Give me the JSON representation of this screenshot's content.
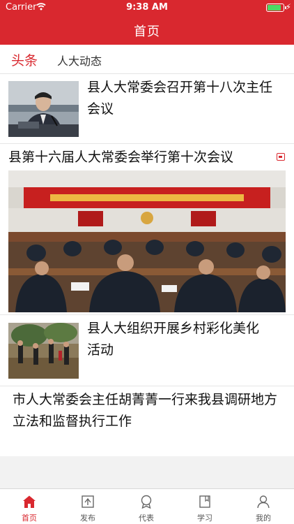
{
  "status_bar": {
    "carrier": "Carrier",
    "wifi_icon": "wifi-icon",
    "time": "9:38 AM",
    "battery_level": 0.9,
    "battery_icon": "battery-icon",
    "charging_icon": "bolt-icon"
  },
  "nav": {
    "title": "首页"
  },
  "tabs": [
    {
      "label": "头条",
      "active": true
    },
    {
      "label": "人大动态",
      "active": false
    }
  ],
  "news": [
    {
      "title": "县人大常委会召开第十八次主任会议",
      "image": "speaker-at-podium-photo"
    },
    {
      "title": "县第十六届人大常委会举行第十次会议",
      "image": "meeting-hall-photo",
      "gallery_icon": "image-gallery-icon"
    },
    {
      "title": "县人大组织开展乡村彩化美化活动",
      "image": "tree-planting-photo"
    },
    {
      "title": " 市人大常委会主任胡菁菁一行来我县调研地方立法和监督执行工作"
    }
  ],
  "tabbar": [
    {
      "label": "首页",
      "icon": "home-icon",
      "active": true
    },
    {
      "label": "发布",
      "icon": "publish-icon",
      "active": false
    },
    {
      "label": "代表",
      "icon": "badge-icon",
      "active": false
    },
    {
      "label": "学习",
      "icon": "book-icon",
      "active": false
    },
    {
      "label": "我的",
      "icon": "person-icon",
      "active": false
    }
  ],
  "colors": {
    "accent": "#d9282f",
    "battery": "#4cd964"
  }
}
